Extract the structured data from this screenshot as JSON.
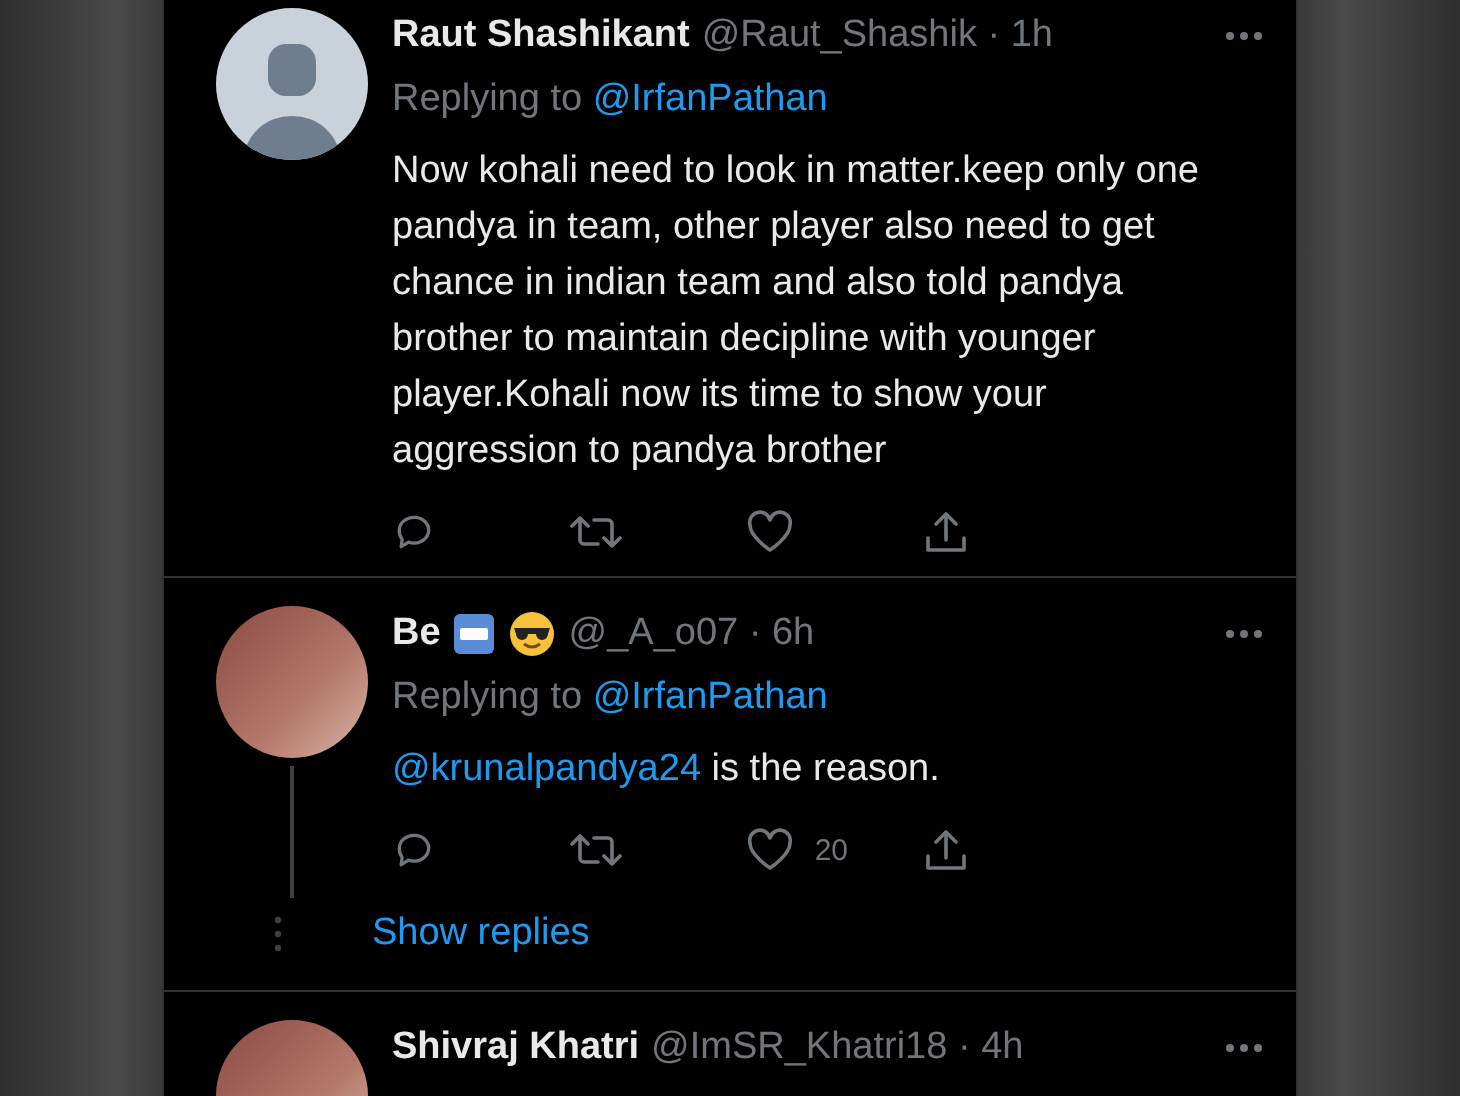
{
  "tweets": [
    {
      "name": "Raut Shashikant",
      "handle": "@Raut_Shashik",
      "separator": "·",
      "time": "1h",
      "avatar": {
        "kind": "default"
      },
      "replying_label": "Replying to",
      "replying_to": "@IrfanPathan",
      "text": "Now kohali need to look in matter.keep only one pandya in team, other player also need to get chance in indian team and also told pandya brother to maintain decipline with younger player.Kohali now its time to show your aggression to pandya brother",
      "thread": false,
      "name_emojis": false
    },
    {
      "name": "Be",
      "handle": "@_A_o07",
      "separator": "·",
      "time": "6h",
      "avatar": {
        "kind": "photo"
      },
      "name_emojis": true,
      "replying_label": "Replying to",
      "replying_to": "@IrfanPathan",
      "mention": "@krunalpandya24",
      "text": " is the reason.",
      "like_count": "20",
      "thread": true,
      "show_replies": "Show replies"
    },
    {
      "name": "Shivraj Khatri",
      "handle": "@ImSR_Khatri18",
      "separator": "·",
      "time": "4h",
      "avatar": {
        "kind": "photo"
      },
      "thread": false,
      "name_emojis": false
    }
  ]
}
